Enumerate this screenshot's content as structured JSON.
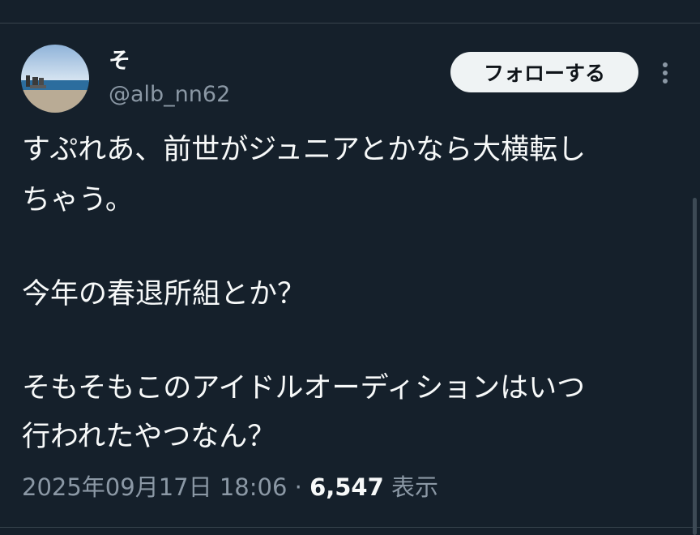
{
  "tweet": {
    "author": {
      "display_name": "そ",
      "handle": "@alb_nn62"
    },
    "follow_label": "フォローする",
    "more_icon": "more-vertical-icon",
    "text_lines": [
      "すぷれあ、前世がジュニアとかなら大横転し",
      "ちゃう。",
      "今年の春退所組とか？",
      "そもそもこのアイドルオーディションはいつ",
      "行われたやつなん？"
    ],
    "timestamp": "2025年09月17日 18:06",
    "separator": "·",
    "views_count": "6,547",
    "views_label": "表示"
  },
  "colors": {
    "background": "#15202b",
    "text": "#f7f9f9",
    "secondary_text": "#8b98a5",
    "button_bg": "#eff3f4",
    "divider": "#38444d"
  }
}
